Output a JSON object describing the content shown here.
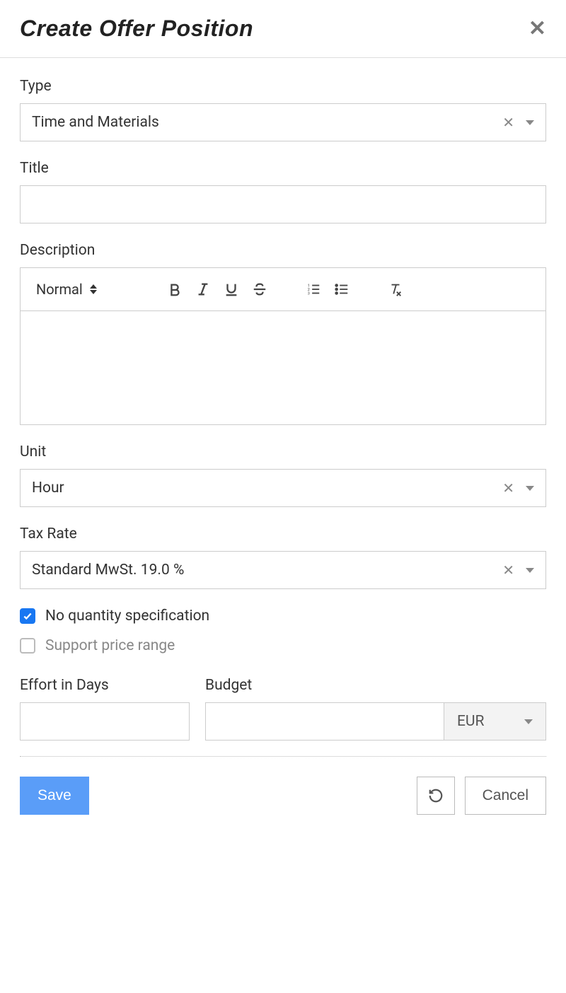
{
  "dialog": {
    "title": "Create Offer Position"
  },
  "fields": {
    "type_label": "Type",
    "type_value": "Time and Materials",
    "title_label": "Title",
    "title_value": "",
    "description_label": "Description",
    "heading_style": "Normal",
    "unit_label": "Unit",
    "unit_value": "Hour",
    "tax_label": "Tax Rate",
    "tax_value": "Standard MwSt. 19.0 %",
    "no_quantity_label": "No quantity specification",
    "no_quantity_checked": true,
    "price_range_label": "Support price range",
    "price_range_checked": false,
    "effort_label": "Effort in Days",
    "effort_value": "",
    "budget_label": "Budget",
    "budget_value": "",
    "currency": "EUR"
  },
  "buttons": {
    "save": "Save",
    "cancel": "Cancel"
  }
}
